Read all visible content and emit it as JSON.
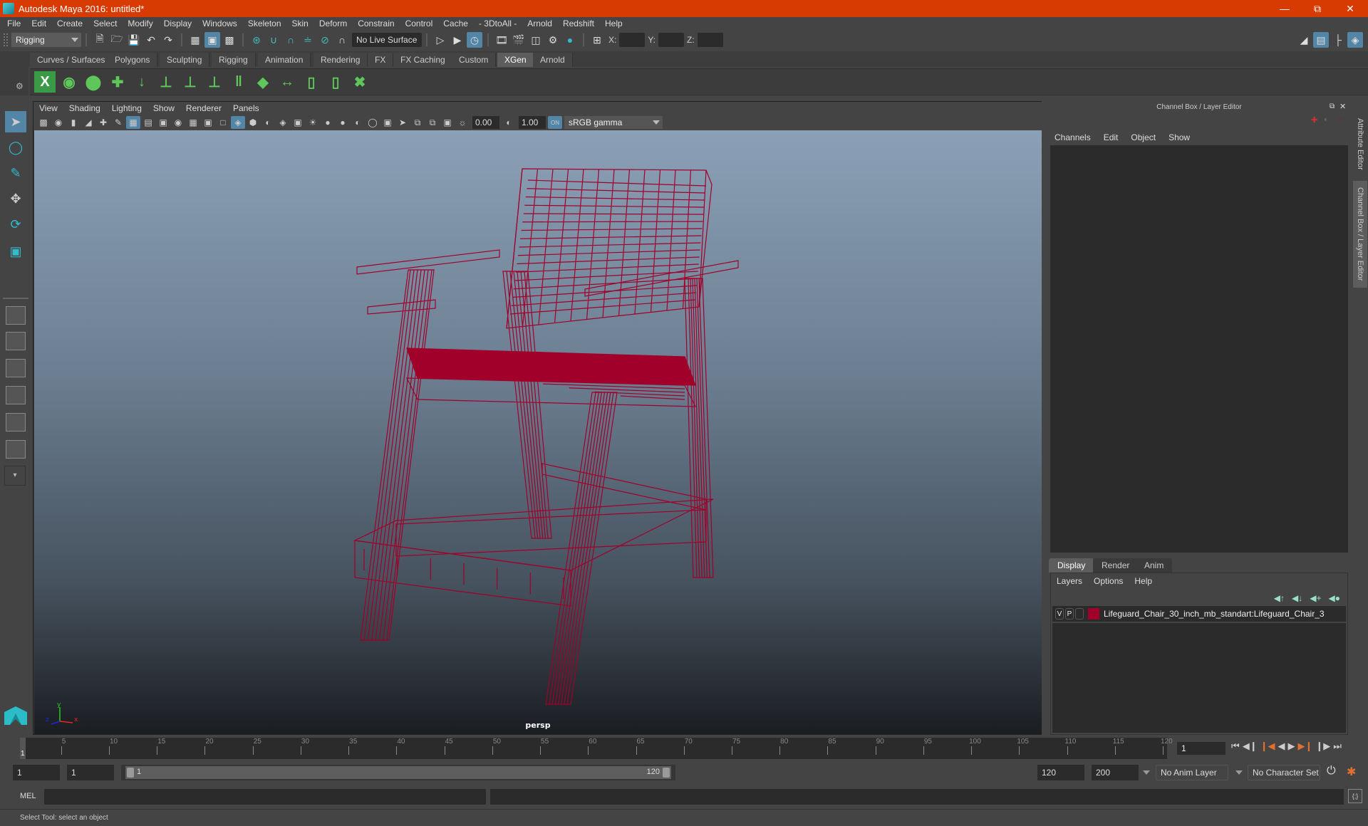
{
  "window": {
    "title": "Autodesk Maya 2016: untitled*",
    "controls": [
      "minimize",
      "restore",
      "close"
    ]
  },
  "menubar": [
    "File",
    "Edit",
    "Create",
    "Select",
    "Modify",
    "Display",
    "Windows",
    "Skeleton",
    "Skin",
    "Deform",
    "Constrain",
    "Control",
    "Cache",
    "- 3DtoAll -",
    "Arnold",
    "Redshift",
    "Help"
  ],
  "statusline": {
    "menuset": "Rigging",
    "live_surface": "No Live Surface",
    "x_label": "X:",
    "y_label": "Y:",
    "z_label": "Z:",
    "x_value": "",
    "y_value": "",
    "z_value": ""
  },
  "shelf": {
    "tabs": [
      "Curves / Surfaces",
      "Polygons",
      "Sculpting",
      "Rigging",
      "Animation",
      "Rendering",
      "FX",
      "FX Caching",
      "Custom",
      "XGen",
      "Arnold"
    ],
    "active_tab": "XGen",
    "icons": [
      "xgen-window-icon",
      "xgen-preview-icon",
      "xgen-clear-preview-icon",
      "xgen-add-guides-icon",
      "xgen-move-guides-icon",
      "xgen-add-guide-icon",
      "xgen-sculpt-guide-icon",
      "xgen-lock-guide-icon",
      "xgen-guide-length-icon",
      "xgen-rebuild-icon",
      "xgen-flip-guides-icon",
      "xgen-select-guides-icon",
      "xgen-guide-cage-icon",
      "xgen-delete-guides-icon"
    ]
  },
  "toolbox": [
    "select-tool",
    "lasso-tool",
    "paint-select-tool",
    "move-tool",
    "rotate-tool",
    "scale-tool"
  ],
  "viewport": {
    "menus": [
      "View",
      "Shading",
      "Lighting",
      "Show",
      "Renderer",
      "Panels"
    ],
    "exposure": "0.00",
    "gamma": "1.00",
    "color_space": "sRGB gamma",
    "camera": "persp",
    "axis": {
      "x": "x",
      "y": "y",
      "z": "z"
    },
    "wireframe_color": "#a0002a"
  },
  "channelbox": {
    "title": "Channel Box / Layer Editor",
    "menus": [
      "Channels",
      "Edit",
      "Object",
      "Show"
    ]
  },
  "layer_editor": {
    "tabs": [
      "Display",
      "Render",
      "Anim"
    ],
    "active_tab": "Display",
    "menus": [
      "Layers",
      "Options",
      "Help"
    ],
    "layers": [
      {
        "v": "V",
        "p": "P",
        "color": "#a0002a",
        "name": "Lifeguard_Chair_30_inch_mb_standart:Lifeguard_Chair_3"
      }
    ]
  },
  "side_tabs": [
    "Attribute Editor",
    "Channel Box / Layer Editor"
  ],
  "timeline": {
    "start": 1,
    "end": 120,
    "current": 1,
    "labels": [
      "5",
      "10",
      "15",
      "20",
      "25",
      "30",
      "35",
      "40",
      "45",
      "50",
      "55",
      "60",
      "65",
      "70",
      "75",
      "80",
      "85",
      "90",
      "95",
      "100",
      "105",
      "110",
      "115",
      "120"
    ],
    "current_frame_field": "1"
  },
  "range": {
    "start_field": "1",
    "playback_start": "1",
    "slider_start": "1",
    "slider_end": "120",
    "playback_end": "120",
    "end_field": "200",
    "anim_layer": "No Anim Layer",
    "character_set": "No Character Set"
  },
  "command_line": {
    "label": "MEL"
  },
  "help_line": "Select Tool: select an object"
}
